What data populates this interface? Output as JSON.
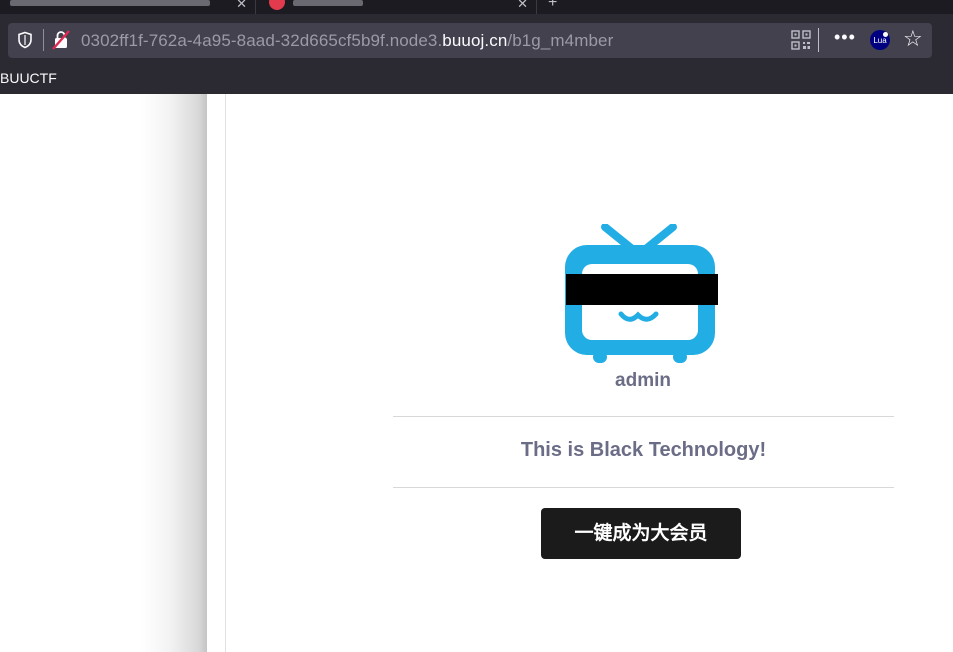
{
  "browser": {
    "url": {
      "prefix": "0302ff1f-762a-4a95-8aad-32d665cf5b9f.node3.",
      "host": "buuoj.cn",
      "path": "/b1g_m4mber"
    },
    "bookmarks": [
      {
        "label": "BUUCTF"
      }
    ],
    "icons": {
      "shield": "shield-icon",
      "insecure": "insecure-lock-icon",
      "qr": "qr-code-icon",
      "more": "more-icon",
      "lua": "lua-extension-icon",
      "star": "bookmark-star-icon"
    },
    "extension_label": "Lua"
  },
  "profile": {
    "username": "admin",
    "logo_icon": "bilibili-tv-icon",
    "logo_color": "#23ade5",
    "message": "This is Black Technology!",
    "vip_button_label": "一键成为大会员"
  },
  "colors": {
    "text_muted": "#6b6d87",
    "button_bg": "#1b1b1b",
    "chrome_bg": "#2b2a33",
    "urlbar_bg": "#42414d"
  }
}
